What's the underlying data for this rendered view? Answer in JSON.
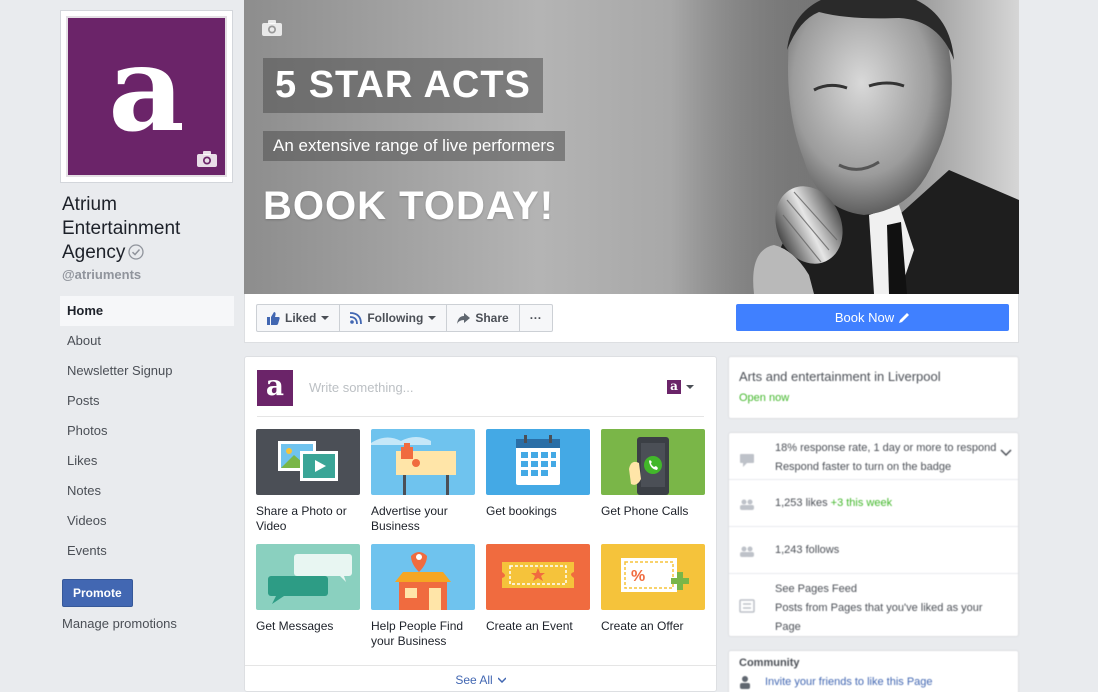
{
  "page": {
    "name": "Atrium Entertainment Agency",
    "name_lines": [
      "Atrium",
      "Entertainment",
      "Agency"
    ],
    "handle": "@atriuments",
    "avatar_letter": "a",
    "brand_color": "#6b2469"
  },
  "nav": {
    "items": [
      {
        "label": "Home",
        "active": true
      },
      {
        "label": "About"
      },
      {
        "label": "Newsletter Signup"
      },
      {
        "label": "Posts"
      },
      {
        "label": "Photos"
      },
      {
        "label": "Likes"
      },
      {
        "label": "Notes"
      },
      {
        "label": "Videos"
      },
      {
        "label": "Events"
      }
    ],
    "promote_label": "Promote",
    "manage_label": "Manage promotions"
  },
  "cover": {
    "headline": "5 STAR ACTS",
    "tagline": "An extensive range of live performers",
    "cta": "BOOK TODAY!"
  },
  "actions": {
    "liked": "Liked",
    "following": "Following",
    "share": "Share",
    "more": "···",
    "book_now": "Book Now"
  },
  "composer": {
    "placeholder": "Write something...",
    "tiles": [
      {
        "label": "Share a Photo or Video",
        "bg": "#4b4f56"
      },
      {
        "label": "Advertise your Business",
        "bg": "#6fc3ee"
      },
      {
        "label": "Get bookings",
        "bg": "#44a9e5"
      },
      {
        "label": "Get Phone Calls",
        "bg": "#7ab648"
      },
      {
        "label": "Get Messages",
        "bg": "#8ad0bf"
      },
      {
        "label": "Help People Find your Business",
        "bg": "#6fc3ee"
      },
      {
        "label": "Create an Event",
        "bg": "#f06b3f"
      },
      {
        "label": "Create an Offer",
        "bg": "#f5c33b"
      }
    ],
    "see_all": "See All"
  },
  "sidebar": {
    "category": "Arts and entertainment in Liverpool",
    "open_status": "Open now",
    "response": "18% response rate, 1 day or more to respond",
    "response_hint": "Respond faster to turn on the badge",
    "likes": "1,253 likes",
    "likes_delta": "+3 this week",
    "follows": "1,243 follows",
    "pages_feed": "See Pages Feed",
    "pages_feed_desc": "Posts from Pages that you've liked as your Page",
    "community": "Community",
    "invite": "Invite your friends to like this Page"
  },
  "colors": {
    "background": "#e9ebee",
    "facebook_blue": "#4267b2",
    "book_now_blue": "#4080ff"
  }
}
